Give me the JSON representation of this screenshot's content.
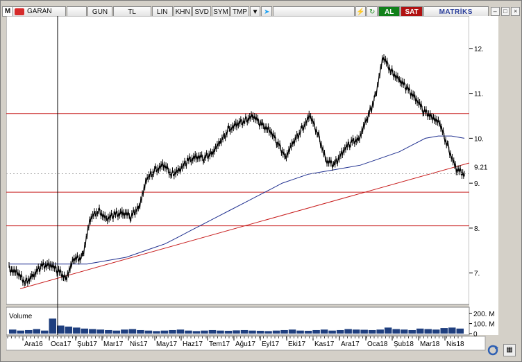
{
  "toolbar": {
    "menu_letter": "M",
    "symbol": "GARAN",
    "period": "GUN",
    "currency": "TL",
    "lin": "LIN",
    "khn": "KHN",
    "svd": "SVD",
    "sym": "SYM",
    "tmp": "TMP",
    "buy": "AL",
    "sell": "SAT",
    "brand": "MATRİKS"
  },
  "chart_data": {
    "type": "line",
    "title": "",
    "symbol": "GARAN",
    "ylim": [
      6.3,
      12.6
    ],
    "y_ticks": [
      "7.",
      "8.",
      "9.",
      "10.",
      "11.",
      "12."
    ],
    "last_price_label": "9.21",
    "last_price": 9.21,
    "x_labels": [
      "Ara16",
      "Oca17",
      "Şub17",
      "Mar17",
      "Nis17",
      "May17",
      "Haz17",
      "Tem17",
      "Ağu17",
      "Eyl17",
      "Eki17",
      "Kas17",
      "Ara17",
      "Oca18",
      "Şub18",
      "Mar18",
      "Nis18"
    ],
    "colors": {
      "price": "#000000",
      "ma": "#1f2f8f",
      "levels": "#c81e1e",
      "volume": "#1f3f7f"
    },
    "horizontal_levels": [
      10.55,
      8.8,
      8.05
    ],
    "price_close": [
      7.1,
      7.0,
      6.8,
      6.95,
      7.15,
      7.2,
      7.05,
      6.9,
      7.3,
      7.35,
      8.2,
      8.4,
      8.2,
      8.3,
      8.35,
      8.25,
      8.5,
      9.1,
      9.3,
      9.4,
      9.2,
      9.3,
      9.5,
      9.6,
      9.55,
      9.7,
      9.9,
      10.2,
      10.3,
      10.4,
      10.5,
      10.3,
      10.2,
      9.9,
      9.6,
      9.9,
      10.2,
      10.5,
      10.1,
      9.5,
      9.4,
      9.7,
      9.9,
      10.0,
      10.4,
      10.9,
      11.8,
      11.5,
      11.3,
      11.1,
      10.9,
      10.6,
      10.5,
      10.3,
      9.8,
      9.3,
      9.21
    ],
    "ma_200": [
      7.2,
      7.2,
      7.2,
      7.2,
      7.2,
      7.2,
      7.2,
      7.25,
      7.3,
      7.35,
      7.45,
      7.55,
      7.65,
      7.8,
      7.95,
      8.1,
      8.25,
      8.4,
      8.55,
      8.7,
      8.85,
      9.0,
      9.1,
      9.2,
      9.25,
      9.3,
      9.35,
      9.4,
      9.5,
      9.6,
      9.7,
      9.85,
      10.0,
      10.05,
      10.05,
      10.0
    ],
    "trend_line": {
      "start": [
        "Ara16",
        6.65
      ],
      "end": [
        "Nis18",
        9.45
      ]
    },
    "volume": {
      "label": "Volume",
      "ticks": [
        "200. M",
        "100. M",
        "0"
      ],
      "values": [
        40,
        30,
        35,
        45,
        30,
        150,
        80,
        70,
        60,
        50,
        45,
        40,
        35,
        30,
        40,
        45,
        35,
        30,
        25,
        30,
        35,
        40,
        30,
        25,
        30,
        35,
        30,
        28,
        32,
        35,
        30,
        28,
        25,
        30,
        35,
        40,
        30,
        28,
        35,
        40,
        30,
        35,
        45,
        40,
        38,
        35,
        40,
        60,
        45,
        40,
        35,
        50,
        45,
        40,
        55,
        60,
        50
      ]
    }
  }
}
